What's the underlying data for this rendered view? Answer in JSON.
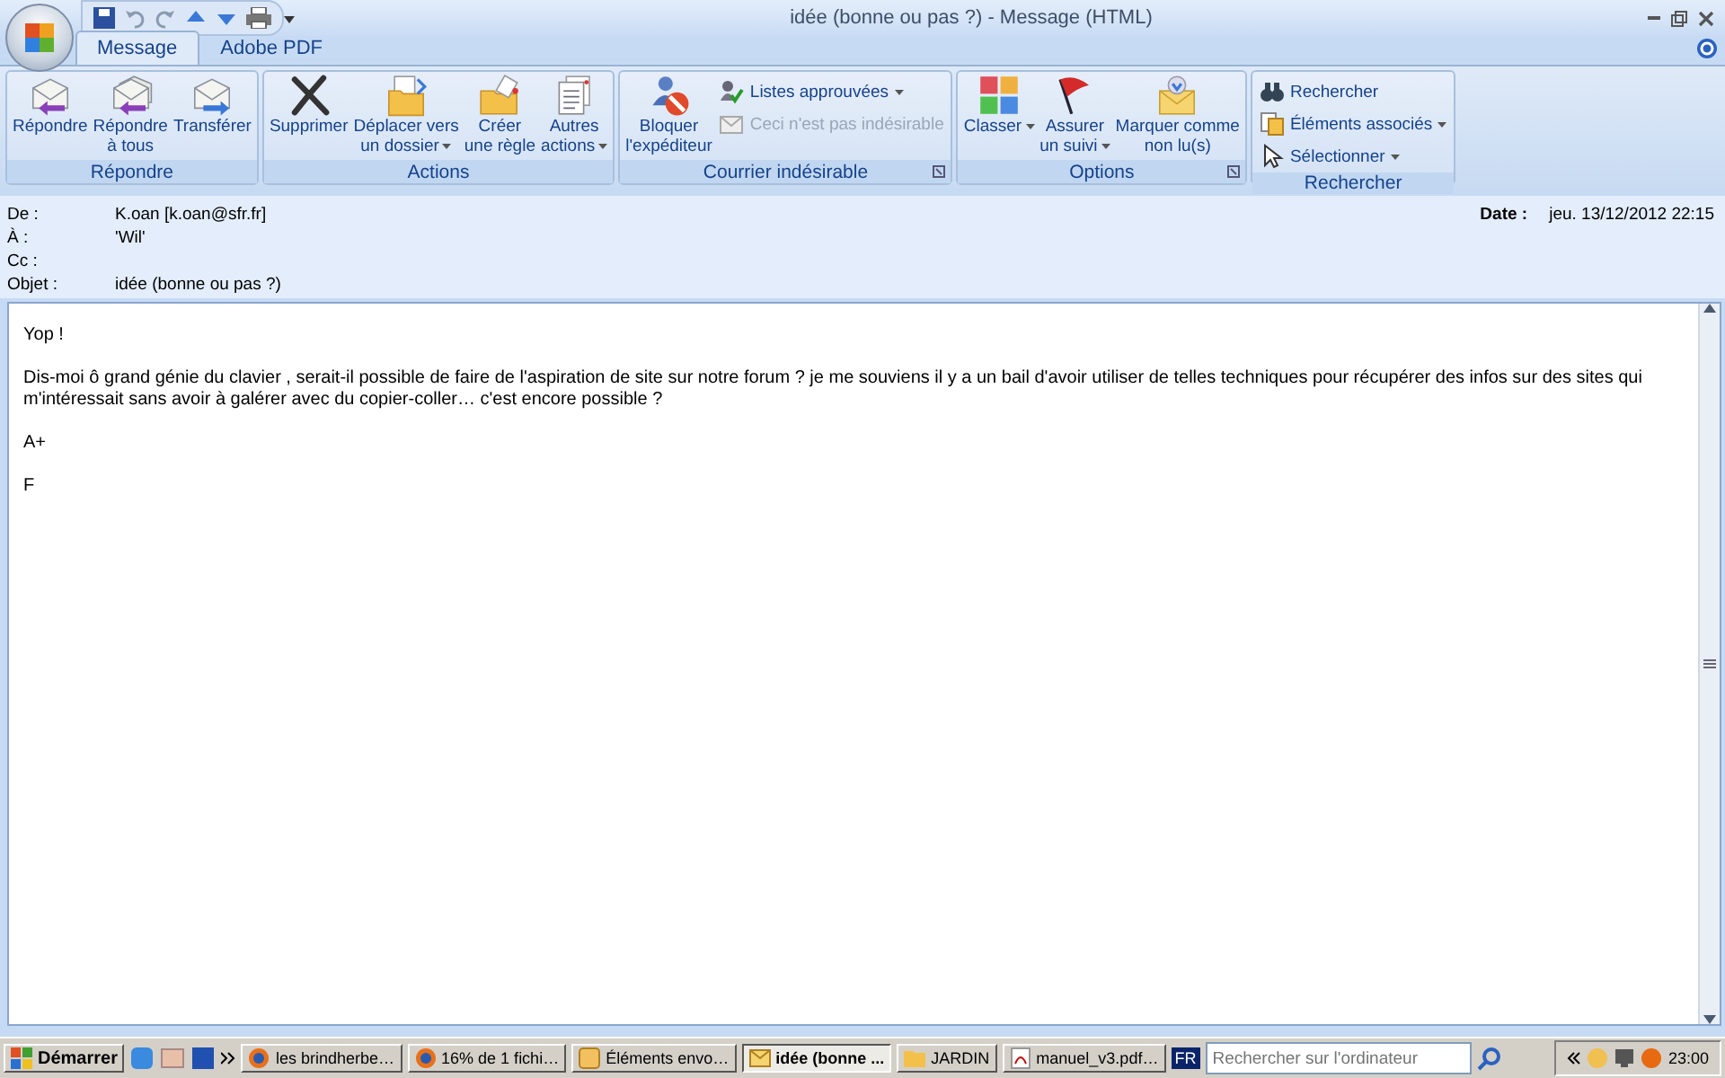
{
  "window": {
    "title": "idée (bonne ou pas ?) - Message (HTML)"
  },
  "tabs": [
    {
      "label": "Message",
      "selected": true
    },
    {
      "label": "Adobe PDF",
      "selected": false
    }
  ],
  "ribbon": {
    "groups": [
      {
        "label": "Répondre",
        "launcher": false,
        "buttons": [
          {
            "kind": "large",
            "lines": [
              "Répondre"
            ],
            "caret": false,
            "disabled": false
          },
          {
            "kind": "large",
            "lines": [
              "Répondre",
              "à tous"
            ],
            "caret": false,
            "disabled": false
          },
          {
            "kind": "large",
            "lines": [
              "Transférer"
            ],
            "caret": false,
            "disabled": false
          }
        ]
      },
      {
        "label": "Actions",
        "launcher": false,
        "buttons": [
          {
            "kind": "large",
            "lines": [
              "Supprimer"
            ],
            "caret": false,
            "disabled": false
          },
          {
            "kind": "large",
            "lines": [
              "Déplacer vers",
              "un dossier"
            ],
            "caret": true,
            "disabled": false
          },
          {
            "kind": "large",
            "lines": [
              "Créer",
              "une règle"
            ],
            "caret": false,
            "disabled": false
          },
          {
            "kind": "large",
            "lines": [
              "Autres",
              "actions"
            ],
            "caret": true,
            "disabled": false
          }
        ]
      },
      {
        "label": "Courrier indésirable",
        "launcher": true,
        "buttons": [
          {
            "kind": "large",
            "lines": [
              "Bloquer",
              "l'expéditeur"
            ],
            "caret": false,
            "disabled": false
          },
          {
            "kind": "small",
            "lines": [
              "Listes approuvées"
            ],
            "caret": true,
            "disabled": false
          },
          {
            "kind": "small",
            "lines": [
              "Ceci n'est pas indésirable"
            ],
            "caret": false,
            "disabled": true
          }
        ]
      },
      {
        "label": "Options",
        "launcher": true,
        "buttons": [
          {
            "kind": "large",
            "lines": [
              "Classer"
            ],
            "caret": true,
            "disabled": false
          },
          {
            "kind": "large",
            "lines": [
              "Assurer",
              "un suivi"
            ],
            "caret": true,
            "disabled": false
          },
          {
            "kind": "large",
            "lines": [
              "Marquer comme",
              "non lu(s)"
            ],
            "caret": false,
            "disabled": false
          }
        ]
      },
      {
        "label": "Rechercher",
        "launcher": false,
        "buttons": [
          {
            "kind": "small",
            "lines": [
              "Rechercher"
            ],
            "caret": false,
            "disabled": false
          },
          {
            "kind": "small",
            "lines": [
              "Éléments associés"
            ],
            "caret": true,
            "disabled": false
          },
          {
            "kind": "small",
            "lines": [
              "Sélectionner"
            ],
            "caret": true,
            "disabled": false
          }
        ]
      }
    ]
  },
  "header": {
    "fields": [
      {
        "label": "De :",
        "value": "K.oan [k.oan@sfr.fr]"
      },
      {
        "label": "À :",
        "value": "'Wil'"
      },
      {
        "label": "Cc :"
      },
      {
        "label": "Objet :",
        "value": "idée (bonne ou pas ?)"
      }
    ],
    "date": {
      "label": "Date :",
      "value": "jeu. 13/12/2012 22:15"
    }
  },
  "body": {
    "paragraphs": [
      "Yop !",
      "Dis-moi ô grand génie du clavier , serait-il possible de faire de l'aspiration de site sur notre forum ? je me souviens il y a un bail d'avoir utiliser de telles techniques pour récupérer des infos sur des sites qui m'intéressait sans avoir à galérer avec du copier-coller… c'est encore possible ?",
      "A+",
      "F"
    ]
  },
  "taskbar": {
    "start": "Démarrer",
    "tasks": [
      {
        "label": "les brindherbe…",
        "selected": false
      },
      {
        "label": "16% de 1 fichi…",
        "selected": false
      },
      {
        "label": "Éléments envo…",
        "selected": false
      },
      {
        "label": "idée (bonne ...",
        "selected": true
      },
      {
        "label": "JARDIN",
        "selected": false
      },
      {
        "label": "manuel_v3.pdf…",
        "selected": false
      }
    ],
    "language": "FR",
    "search": {
      "placeholder": "Rechercher sur l'ordinateur"
    },
    "clock": "23:00"
  }
}
